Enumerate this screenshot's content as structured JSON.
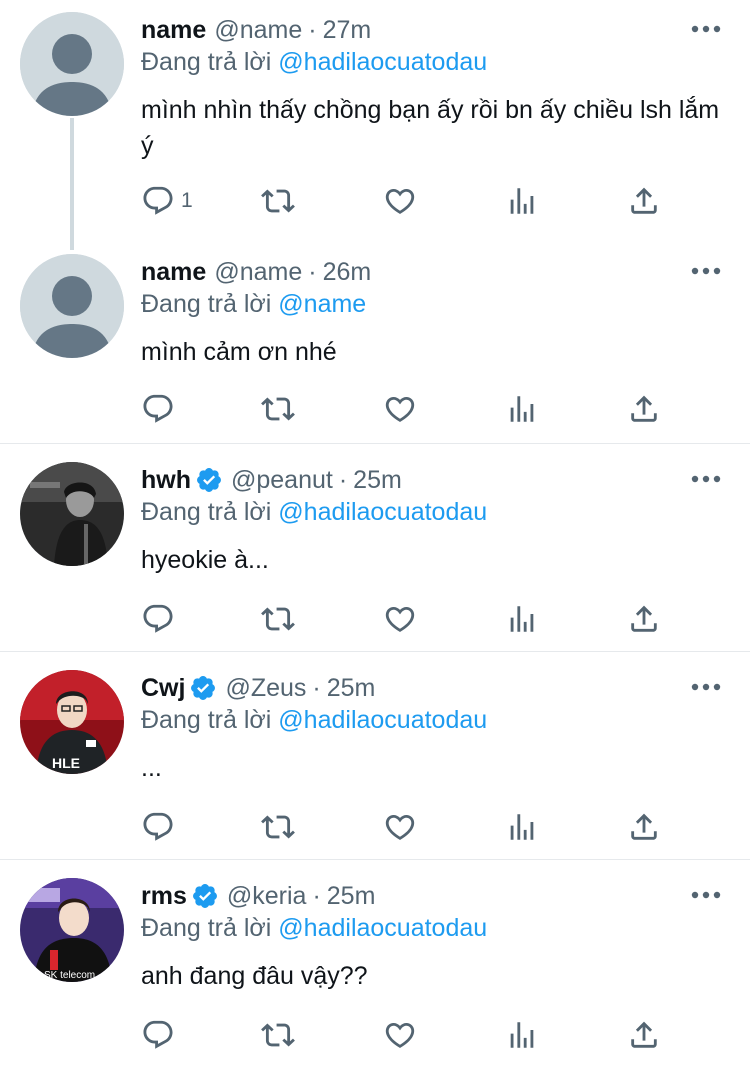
{
  "reply_prefix": "Đang trả lời",
  "dot": "·",
  "tweets": [
    {
      "display_name": "name",
      "handle": "@name",
      "time": "27m",
      "replying_to": "@hadilaocuatodau",
      "text": "mình nhìn thấy chồng bạn ấy rồi bn ấy chiều lsh lắm ý",
      "reply_count": "1",
      "verified": false,
      "avatar_icon": "default-avatar-icon"
    },
    {
      "display_name": "name",
      "handle": "@name",
      "time": "26m",
      "replying_to": "@name",
      "text": "mình cảm ơn nhé",
      "reply_count": "",
      "verified": false,
      "avatar_icon": "default-avatar-icon"
    },
    {
      "display_name": "hwh",
      "handle": "@peanut",
      "time": "25m",
      "replying_to": "@hadilaocuatodau",
      "text": "hyeokie à...",
      "reply_count": "",
      "verified": true,
      "avatar_icon": "photo-avatar-bw"
    },
    {
      "display_name": "Cwj",
      "handle": "@Zeus",
      "time": "25m",
      "replying_to": "@hadilaocuatodau",
      "text": "...",
      "reply_count": "",
      "verified": true,
      "avatar_icon": "photo-avatar-red"
    },
    {
      "display_name": "rms",
      "handle": "@keria",
      "time": "25m",
      "replying_to": "@hadilaocuatodau",
      "text": "anh đang đâu vậy??",
      "reply_count": "",
      "verified": true,
      "avatar_icon": "photo-avatar-purple"
    }
  ],
  "colors": {
    "accent": "#1d9bf0",
    "secondary_text": "#536471",
    "icon": "#536471",
    "divider": "#e6e9ec",
    "thread_line": "#cfd9de"
  }
}
